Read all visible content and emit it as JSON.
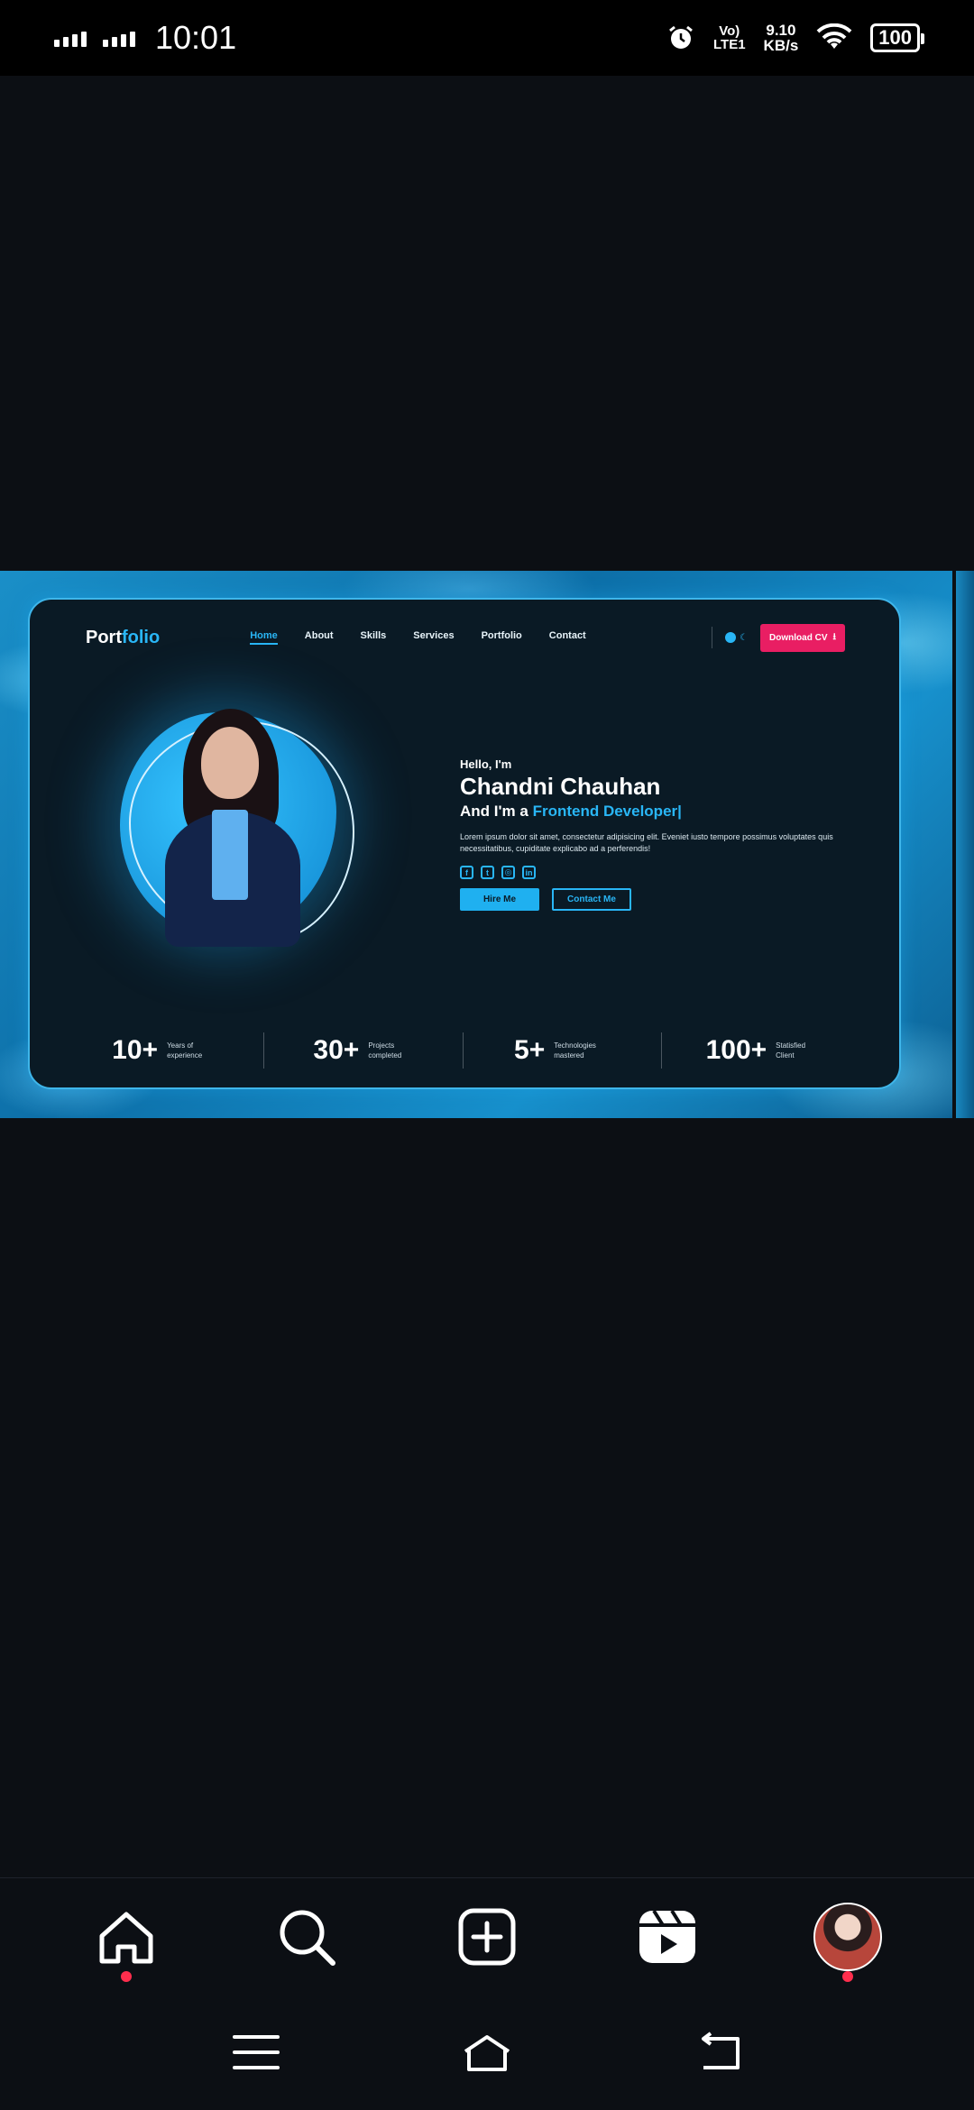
{
  "status_bar": {
    "time": "10:01",
    "network_line1": "Vo)",
    "network_line2": "LTE1",
    "speed_value": "9.10",
    "speed_unit": "KB/s",
    "battery": "100"
  },
  "portfolio": {
    "logo_part1": "Port",
    "logo_part2": "folio",
    "nav_links": [
      "Home",
      "About",
      "Skills",
      "Services",
      "Portfolio",
      "Contact"
    ],
    "download_label": "Download CV",
    "hello": "Hello, I'm",
    "name": "Chandni Chauhan",
    "role_prefix": "And I'm a ",
    "role_highlight": "Frontend Developer|",
    "description": "Lorem ipsum dolor sit amet, consectetur adipisicing elit. Eveniet iusto tempore possimus voluptates quis necessitatibus, cupiditate explicabo ad a perferendis!",
    "hire_label": "Hire Me",
    "contact_label": "Contact Me",
    "stats": [
      {
        "num": "10+",
        "label": "Years of experience"
      },
      {
        "num": "30+",
        "label": "Projects completed"
      },
      {
        "num": "5+",
        "label": "Technologies mastered"
      },
      {
        "num": "100+",
        "label": "Statisfied Client"
      }
    ]
  },
  "bottom_nav": [
    "home-icon",
    "search-icon",
    "create-icon",
    "reels-icon",
    "profile-avatar"
  ],
  "system_nav": [
    "menu-icon",
    "home-icon",
    "back-icon"
  ],
  "colors": {
    "accent": "#29b6f6",
    "download": "#e91e63",
    "notification": "#ff2e4d"
  }
}
